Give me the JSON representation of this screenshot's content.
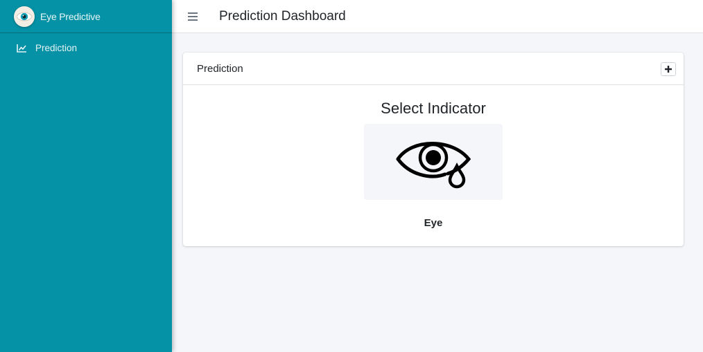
{
  "sidebar": {
    "brand_name": "Eye Predictive",
    "items": [
      {
        "label": "Prediction",
        "icon": "chart-line-icon"
      }
    ]
  },
  "header": {
    "title": "Prediction Dashboard"
  },
  "card": {
    "title": "Prediction",
    "tool_icon": "plus-icon",
    "indicator_title": "Select Indicator",
    "indicators": [
      {
        "label": "Eye",
        "icon": "eye-tear-icon"
      }
    ]
  },
  "colors": {
    "sidebar": "#0592a6",
    "background": "#f4f6f9",
    "card": "#ffffff"
  }
}
